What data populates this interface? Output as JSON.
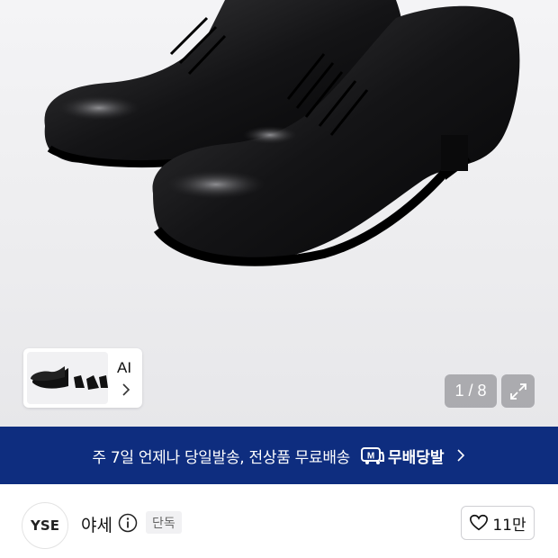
{
  "gallery": {
    "thumbnail_label": "AI",
    "counter": "1 / 8"
  },
  "banner": {
    "text": "주 7일 언제나 당일발송, 전상품 무료배송",
    "logo_mark": "M",
    "logo_text": "무배당발"
  },
  "store": {
    "logo_text": "YSE",
    "name": "야세",
    "badge": "단독",
    "likes": "11만"
  },
  "colors": {
    "banner_bg": "#0e2d7f",
    "text_primary": "#111111"
  },
  "icons": [
    "chevron-right-icon",
    "expand-icon",
    "info-icon",
    "heart-icon",
    "truck-m-icon"
  ]
}
